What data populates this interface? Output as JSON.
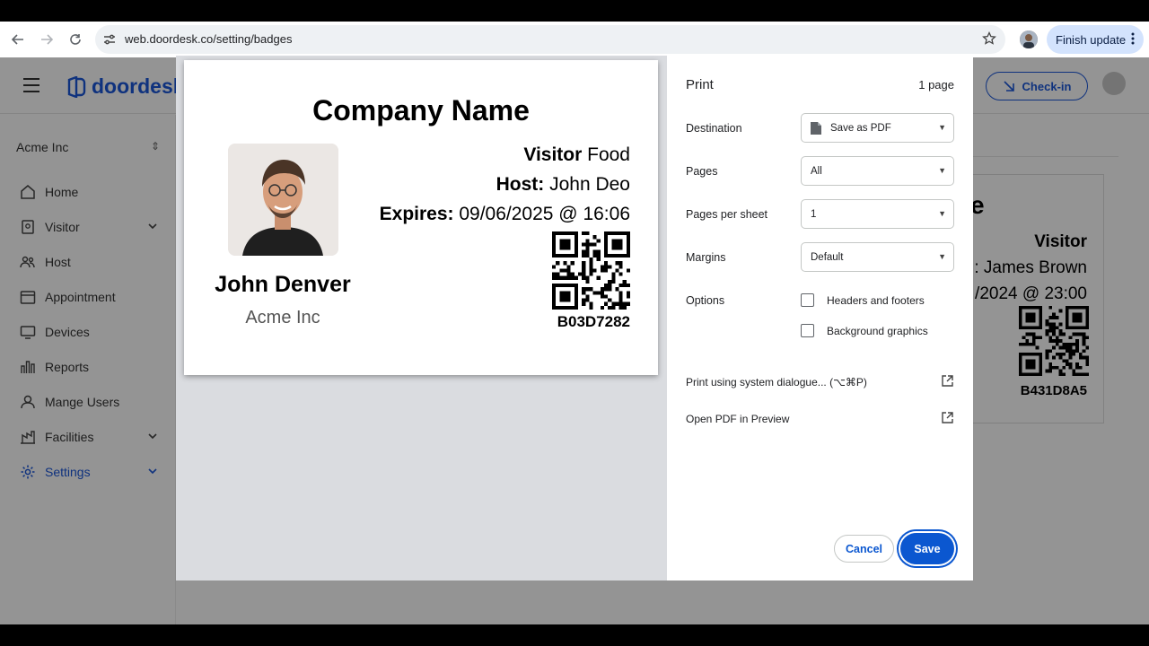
{
  "browser": {
    "url": "web.doordesk.co/setting/badges",
    "finish_update_label": "Finish update"
  },
  "app": {
    "logo_text": "doordesk",
    "checkin_label": "Check-in",
    "org_name": "Acme Inc",
    "sidebar": [
      {
        "label": "Home",
        "icon": "home-icon",
        "chevron": false,
        "active": false
      },
      {
        "label": "Visitor",
        "icon": "visitor-icon",
        "chevron": true,
        "active": false
      },
      {
        "label": "Host",
        "icon": "users-icon",
        "chevron": false,
        "active": false
      },
      {
        "label": "Appointment",
        "icon": "calendar-icon",
        "chevron": false,
        "active": false
      },
      {
        "label": "Devices",
        "icon": "monitor-icon",
        "chevron": false,
        "active": false
      },
      {
        "label": "Reports",
        "icon": "reports-icon",
        "chevron": false,
        "active": false
      },
      {
        "label": "Mange Users",
        "icon": "user-icon",
        "chevron": false,
        "active": false
      },
      {
        "label": "Facilities",
        "icon": "facilities-icon",
        "chevron": true,
        "active": false
      },
      {
        "label": "Settings",
        "icon": "gear-icon",
        "chevron": true,
        "active": true
      }
    ],
    "background_badge": {
      "title_fragment": "e",
      "visitor": "Visitor",
      "host_fragment": ": James Brown",
      "expires_fragment": "/2024 @ 23:00",
      "code": "B431D8A5"
    }
  },
  "print": {
    "title": "Print",
    "page_count": "1 page",
    "destination_label": "Destination",
    "destination_value": "Save as PDF",
    "pages_label": "Pages",
    "pages_value": "All",
    "pages_per_sheet_label": "Pages per sheet",
    "pages_per_sheet_value": "1",
    "margins_label": "Margins",
    "margins_value": "Default",
    "options_label": "Options",
    "option_headers": "Headers and footers",
    "option_background": "Background graphics",
    "system_dialogue": "Print using system dialogue... (⌥⌘P)",
    "open_pdf": "Open PDF in Preview",
    "cancel": "Cancel",
    "save": "Save"
  },
  "badge": {
    "company": "Company Name",
    "visitor_label": "Visitor",
    "visitor_value": "Food",
    "host_label": "Host:",
    "host_value": "John Deo",
    "expires_label": "Expires:",
    "expires_value": "09/06/2025 @ 16:06",
    "name": "John Denver",
    "person_company": "Acme Inc",
    "code": "B03D7282"
  }
}
